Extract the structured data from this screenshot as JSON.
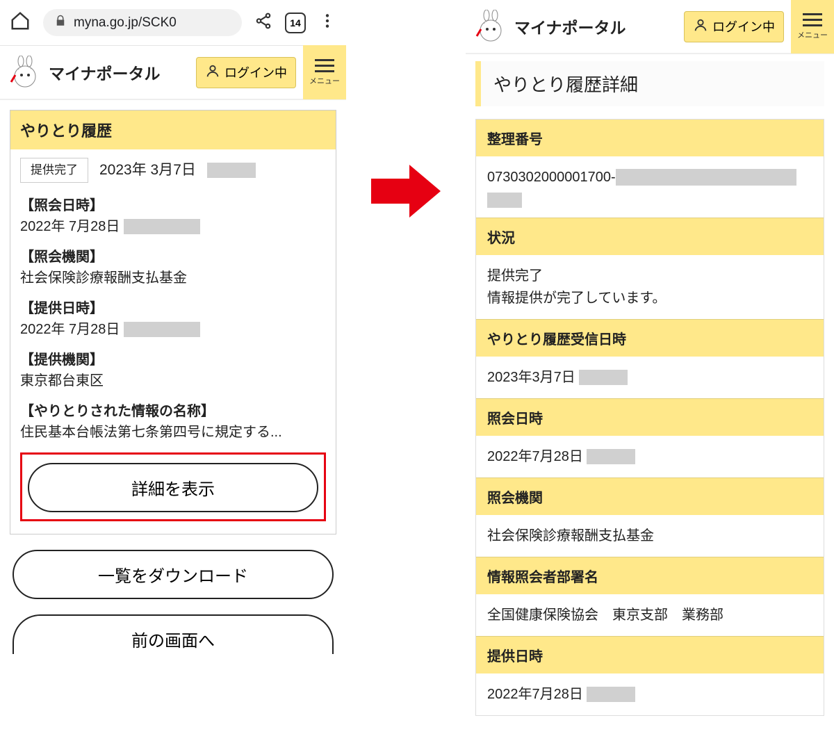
{
  "browser": {
    "url": "myna.go.jp/SCK0",
    "tab_count": "14"
  },
  "header": {
    "app_title": "マイナポータル",
    "login_status": "ログイン中",
    "menu_label": "メニュー"
  },
  "left": {
    "card_title": "やりとり履歴",
    "status_chip": "提供完了",
    "date_main": "2023年 3月7日",
    "fields": {
      "inquiry_date_label": "【照会日時】",
      "inquiry_date_value": "2022年 7月28日",
      "inquiry_org_label": "【照会機関】",
      "inquiry_org_value": "社会保険診療報酬支払基金",
      "provide_date_label": "【提供日時】",
      "provide_date_value": "2022年 7月28日",
      "provide_org_label": "【提供機関】",
      "provide_org_value": "東京都台東区",
      "info_name_label": "【やりとりされた情報の名称】",
      "info_name_value": "住民基本台帳法第七条第四号に規定する..."
    },
    "buttons": {
      "detail": "詳細を表示",
      "download": "一覧をダウンロード",
      "back": "前の画面へ"
    }
  },
  "right": {
    "page_title": "やりとり履歴詳細",
    "rows": {
      "ref_no_label": "整理番号",
      "ref_no_value": "0730302000001700-",
      "status_label": "状況",
      "status_value_1": "提供完了",
      "status_value_2": "情報提供が完了しています。",
      "recv_date_label": "やりとり履歴受信日時",
      "recv_date_value": "2023年3月7日",
      "inquiry_date_label": "照会日時",
      "inquiry_date_value": "2022年7月28日",
      "inquiry_org_label": "照会機関",
      "inquiry_org_value": "社会保険診療報酬支払基金",
      "dept_label": "情報照会者部署名",
      "dept_value": "全国健康保険協会　東京支部　業務部",
      "provide_date_label": "提供日時",
      "provide_date_value": "2022年7月28日"
    }
  }
}
